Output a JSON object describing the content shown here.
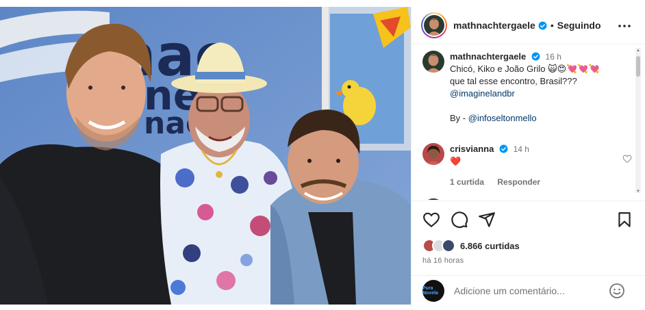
{
  "header": {
    "username": "mathnachtergaele",
    "separator": "•",
    "follow_status": "Seguindo",
    "more_icon": "more-horizontal-icon"
  },
  "caption": {
    "username": "mathnachtergaele",
    "time": "16 h",
    "line1": "Chicó, Kiko e João Grilo",
    "line1_emojis": "🙀😍💘💘💘",
    "line2": "que tal esse encontro, Brasil???",
    "mention": "@imaginelandbr",
    "by_prefix": "By - ",
    "by_mention": "@infoseltonmello"
  },
  "comment1": {
    "username": "crisvianna",
    "time": "14 h",
    "text": "❤️",
    "likes": "1 curtida",
    "reply": "Responder"
  },
  "actions": {
    "like_icon": "heart-icon",
    "comment_icon": "comment-icon",
    "share_icon": "share-icon",
    "save_icon": "bookmark-icon"
  },
  "likes": {
    "count": "6.866 curtidas"
  },
  "posted": {
    "ago": "há 16 horas"
  },
  "add_comment": {
    "placeholder": "Adicione um comentário...",
    "avatar_text": "Pura Novela"
  },
  "photo": {
    "signage": [
      "nao",
      "ne",
      "nao"
    ]
  },
  "colors": {
    "link": "#00376b",
    "verified": "#0095f6",
    "heart": "#ed4956",
    "muted": "#737373"
  }
}
